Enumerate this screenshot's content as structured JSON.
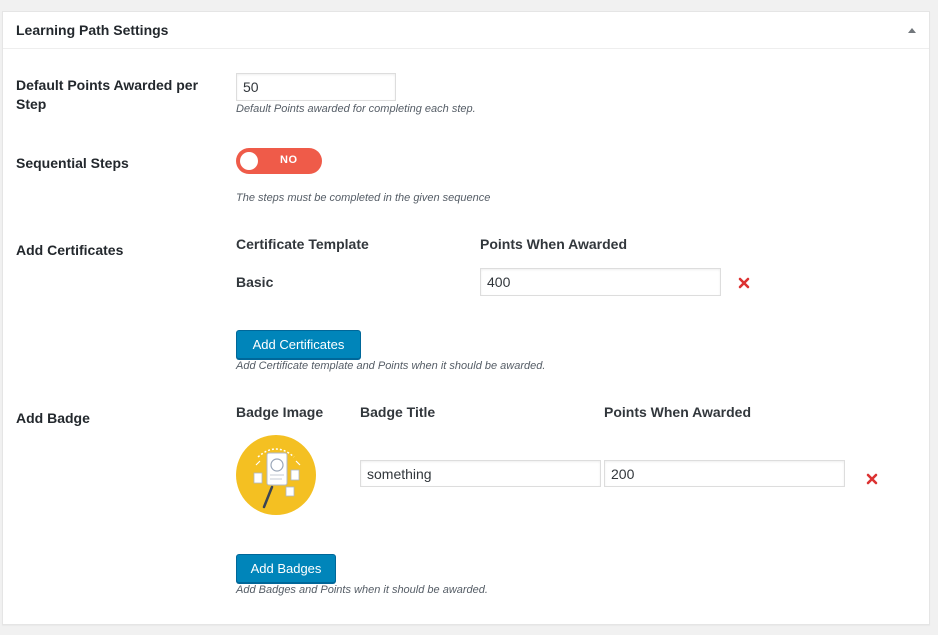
{
  "metabox": {
    "title": "Learning Path Settings",
    "collapse_icon": "triangle-up-icon"
  },
  "default_points": {
    "label": "Default Points Awarded per Step",
    "value": "50",
    "description": "Default Points awarded for completing each step."
  },
  "sequential_steps": {
    "label": "Sequential Steps",
    "toggle_text": "NO",
    "toggle_state": "off",
    "toggle_color": "#ef5b49",
    "description": "The steps must be completed in the given sequence"
  },
  "certificates": {
    "label": "Add Certificates",
    "columns": [
      "Certificate Template",
      "Points When Awarded"
    ],
    "rows": [
      {
        "template": "Basic",
        "points": "400",
        "remove_icon": "close-x-icon"
      }
    ],
    "button_label": "Add Certificates",
    "description": "Add Certificate template and Points when it should be awarded."
  },
  "badges": {
    "label": "Add Badge",
    "columns": [
      "Badge Image",
      "Badge Title",
      "Points When Awarded"
    ],
    "rows": [
      {
        "image_icon": "badge-image",
        "title": "something",
        "points": "200",
        "remove_icon": "close-x-icon"
      }
    ],
    "button_label": "Add Badges",
    "description": "Add Badges and Points when it should be awarded."
  },
  "colors": {
    "primary_button": "#0085ba",
    "remove_icon": "#dc3232",
    "badge_bg": "#f4c022"
  }
}
